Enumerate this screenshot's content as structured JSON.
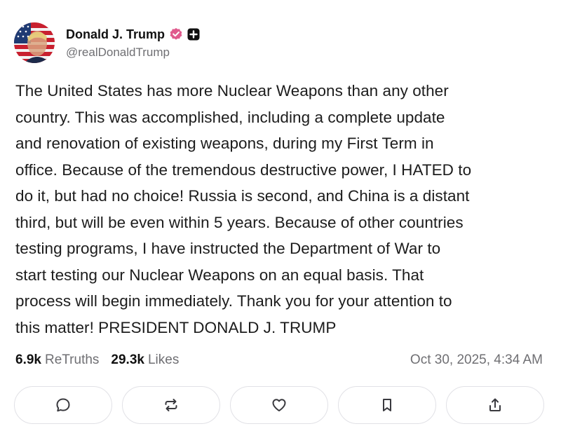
{
  "author": {
    "display_name": "Donald J. Trump",
    "handle": "@realDonaldTrump",
    "avatar_icon": "flag-portrait-avatar",
    "verified_icon": "verified-badge-icon",
    "verified_color": "#e05a8d",
    "plus_badge_icon": "plus-badge-icon"
  },
  "post": {
    "text": "The United States has more Nuclear Weapons than any other\ncountry. This was accomplished, including a complete update\nand renovation of existing weapons, during my First Term in\noffice. Because of the tremendous destructive power, I HATED to\ndo it, but had no choice! Russia is second, and China is a distant\nthird, but will be even within 5 years. Because of other countries\ntesting programs, I have instructed the Department of War to\nstart testing our Nuclear Weapons on an equal basis. That\nprocess will begin immediately. Thank you for your attention to\nthis matter! PRESIDENT DONALD J. TRUMP"
  },
  "stats": {
    "retruths_count": "6.9k",
    "retruths_label": "ReTruths",
    "likes_count": "29.3k",
    "likes_label": "Likes",
    "timestamp": "Oct 30, 2025, 4:34 AM"
  },
  "actions": [
    {
      "icon": "reply-icon"
    },
    {
      "icon": "retruth-icon"
    },
    {
      "icon": "like-icon"
    },
    {
      "icon": "bookmark-icon"
    },
    {
      "icon": "share-icon"
    }
  ],
  "colors": {
    "text": "#1c1c1c",
    "muted": "#6f6f73",
    "button_border": "#e1e1e6"
  }
}
